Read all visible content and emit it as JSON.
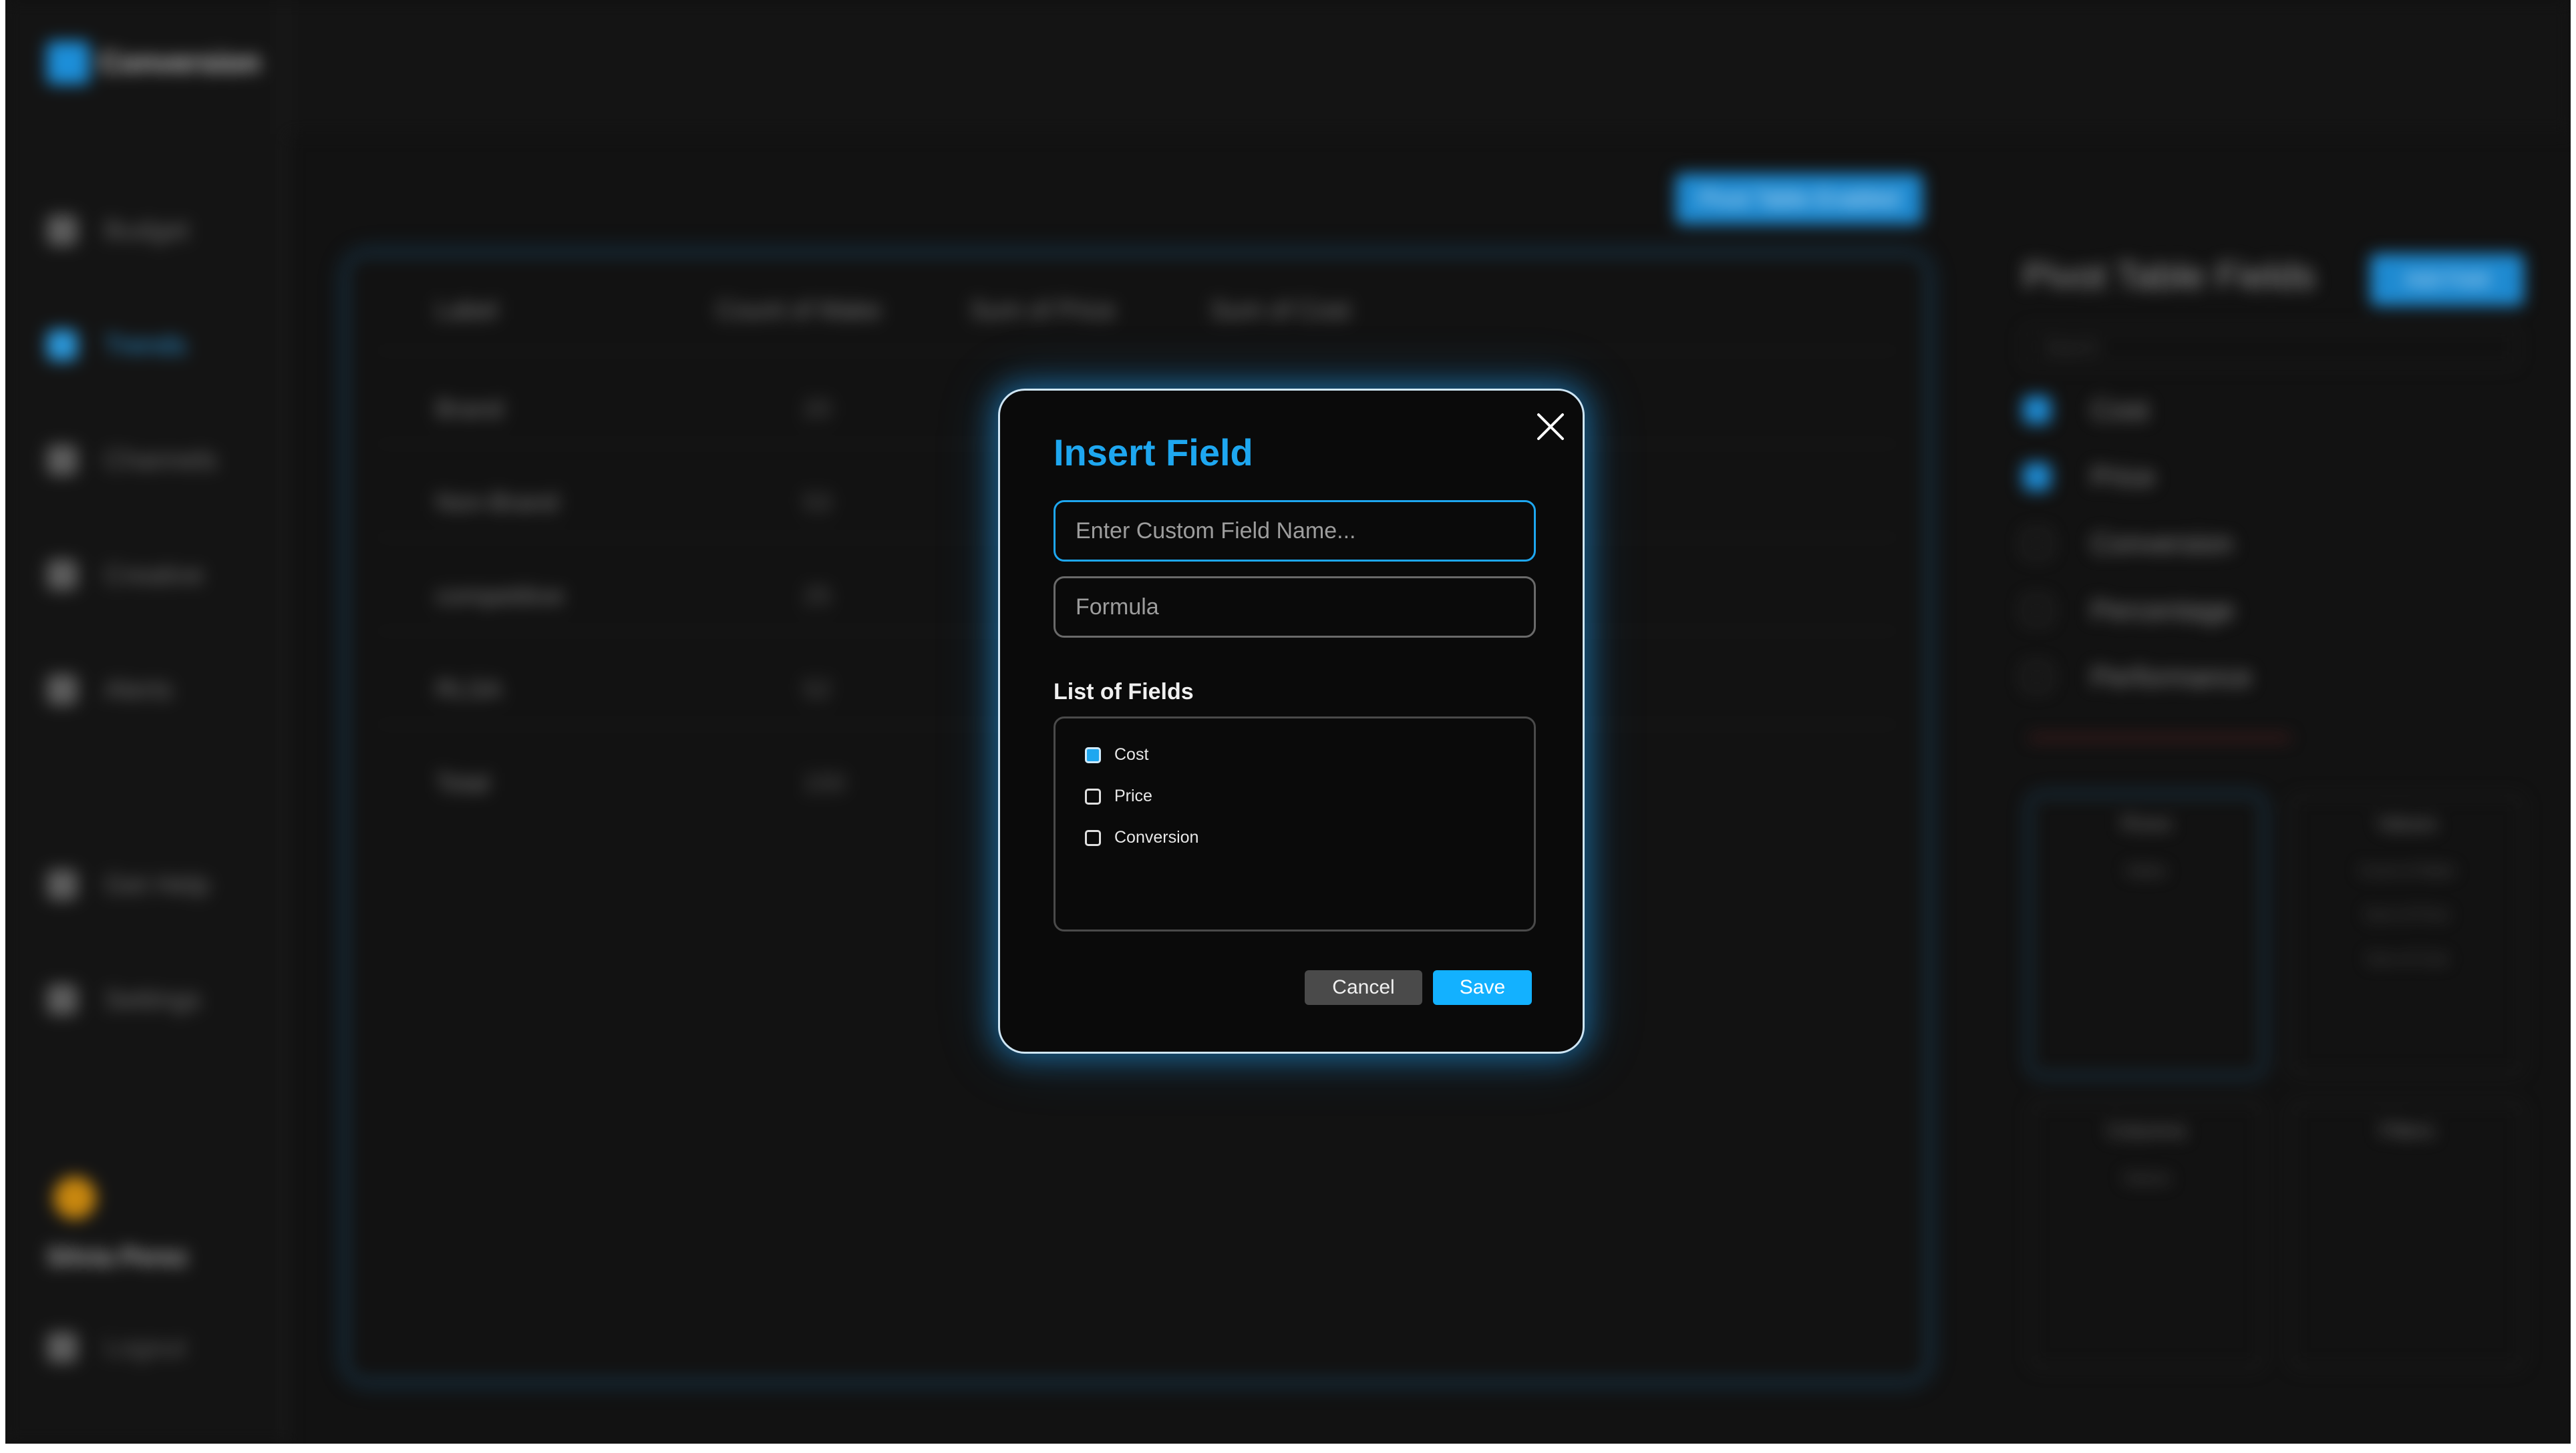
{
  "app": {
    "name": "Conversion"
  },
  "sidebar": {
    "items": [
      {
        "label": "Budget",
        "icon": "dashboard-icon"
      },
      {
        "label": "Trends",
        "icon": "chart-icon",
        "active": true
      },
      {
        "label": "Channels",
        "icon": "channels-icon"
      },
      {
        "label": "Creative",
        "icon": "creative-icon"
      },
      {
        "label": "Alerts",
        "icon": "alert-icon"
      },
      {
        "label": "Get Help",
        "icon": "help-icon"
      },
      {
        "label": "Settings",
        "icon": "settings-icon"
      }
    ],
    "user_name": "Silvia Perez",
    "logout_label": "Logout"
  },
  "main": {
    "pivot_button_label": "Pivot Table Enabled",
    "table": {
      "headers": [
        "Label",
        "Count of Make",
        "Sum of Price",
        "Sum of Cost"
      ],
      "rows": [
        {
          "label": "Brand",
          "count": "20"
        },
        {
          "label": "Non-Brand",
          "count": "53"
        },
        {
          "label": "competitive",
          "count": "25"
        },
        {
          "label": "RLSA",
          "count": "52"
        },
        {
          "label": "Total",
          "count": "150"
        }
      ]
    }
  },
  "pivot_fields": {
    "title": "Pivot Table Fields",
    "add_button_label": "Add Field",
    "search_placeholder": "Search",
    "fields": [
      {
        "label": "Cost",
        "checked": true
      },
      {
        "label": "Price",
        "checked": true
      },
      {
        "label": "Conversion",
        "checked": false
      },
      {
        "label": "Percentage",
        "checked": false
      },
      {
        "label": "Performance",
        "checked": false
      }
    ],
    "zones": {
      "rows": "Rows",
      "values": "Values",
      "columns": "Columns",
      "filters": "Filters"
    },
    "rows_item": "Make",
    "values_items": [
      "Count of Make",
      "Sum of Price",
      "Sum of Cost"
    ],
    "columns_item": "Values"
  },
  "modal": {
    "title": "Insert Field",
    "name_placeholder": "Enter Custom Field Name...",
    "formula_placeholder": "Formula",
    "list_label": "List of Fields",
    "list": [
      {
        "label": "Cost",
        "checked": true
      },
      {
        "label": "Price",
        "checked": false
      },
      {
        "label": "Conversion",
        "checked": false
      }
    ],
    "cancel_label": "Cancel",
    "save_label": "Save"
  },
  "colors": {
    "accent": "#1ea7f0",
    "save_button": "#13b1ff",
    "cancel_button": "#4a4a4a",
    "background": "#121212"
  }
}
